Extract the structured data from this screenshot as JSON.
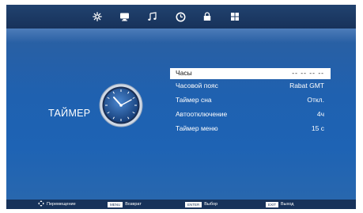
{
  "topbar": {
    "tabs": [
      {
        "icon": "settings-icon",
        "glyph": "✲"
      },
      {
        "icon": "tv-icon",
        "glyph": ""
      },
      {
        "icon": "music-note-icon",
        "glyph": "♫"
      },
      {
        "icon": "clock-icon",
        "glyph": "◷"
      },
      {
        "icon": "lock-icon",
        "glyph": ""
      },
      {
        "icon": "grid-icon",
        "glyph": ""
      }
    ],
    "active_tab": "clock-icon"
  },
  "page": {
    "title": "ТАЙМЕР"
  },
  "menu": {
    "items": [
      {
        "label": "Часы",
        "value": "-- -- -- --",
        "selected": true
      },
      {
        "label": "Часовой пояс",
        "value": "Rabat GMT",
        "selected": false
      },
      {
        "label": "Таймер сна",
        "value": "Откл.",
        "selected": false
      },
      {
        "label": "Автоотключение",
        "value": "4ч",
        "selected": false
      },
      {
        "label": "Таймер меню",
        "value": "15 с",
        "selected": false
      }
    ]
  },
  "bottombar": {
    "move_label": "Перемещение",
    "menu_key": "MENU",
    "menu_label": "Возврат",
    "enter_key": "ENTER",
    "enter_label": "Выбор",
    "exit_key": "EXIT",
    "exit_label": "Выход"
  },
  "colors": {
    "background": "#1f61b0",
    "topbar": "#17325a",
    "selected_row": "#ffffff",
    "text": "#ffffff"
  }
}
